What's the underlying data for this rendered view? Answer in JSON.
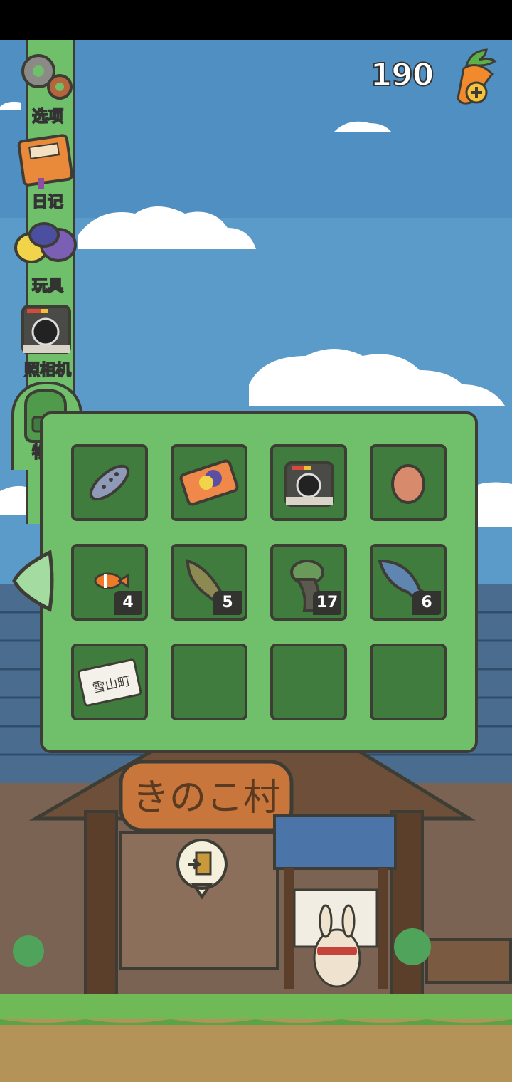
{
  "colors": {
    "sky": "#5b9bc9",
    "menu_green": "#6fbf6b",
    "slot_green": "#3f7c3d",
    "outline": "#3d3d35"
  },
  "currency": {
    "count": "190",
    "icon": "carrot-add-icon"
  },
  "menu": {
    "items": [
      {
        "label": "选项",
        "icon": "gears-icon"
      },
      {
        "label": "日记",
        "icon": "diary-icon"
      },
      {
        "label": "玩具",
        "icon": "toys-icon"
      },
      {
        "label": "照相机",
        "icon": "camera-icon"
      },
      {
        "label": "物品",
        "icon": "backpack-icon",
        "active": true
      }
    ]
  },
  "inventory": {
    "slots": [
      {
        "icon": "remote-control-icon",
        "count": ""
      },
      {
        "icon": "ticket-icon",
        "count": ""
      },
      {
        "icon": "instant-camera-icon",
        "count": ""
      },
      {
        "icon": "egg-icon",
        "count": ""
      },
      {
        "icon": "clownfish-icon",
        "count": "4"
      },
      {
        "icon": "catfish-icon",
        "count": "5"
      },
      {
        "icon": "turtle-icon",
        "count": "17"
      },
      {
        "icon": "blue-fish-icon",
        "count": "6"
      },
      {
        "icon": "train-ticket-icon",
        "count": ""
      },
      {
        "icon": "",
        "count": ""
      },
      {
        "icon": "",
        "count": ""
      },
      {
        "icon": "",
        "count": ""
      }
    ]
  },
  "scene": {
    "station_sign": "きのこ村",
    "ticket_text": "雪山町"
  }
}
